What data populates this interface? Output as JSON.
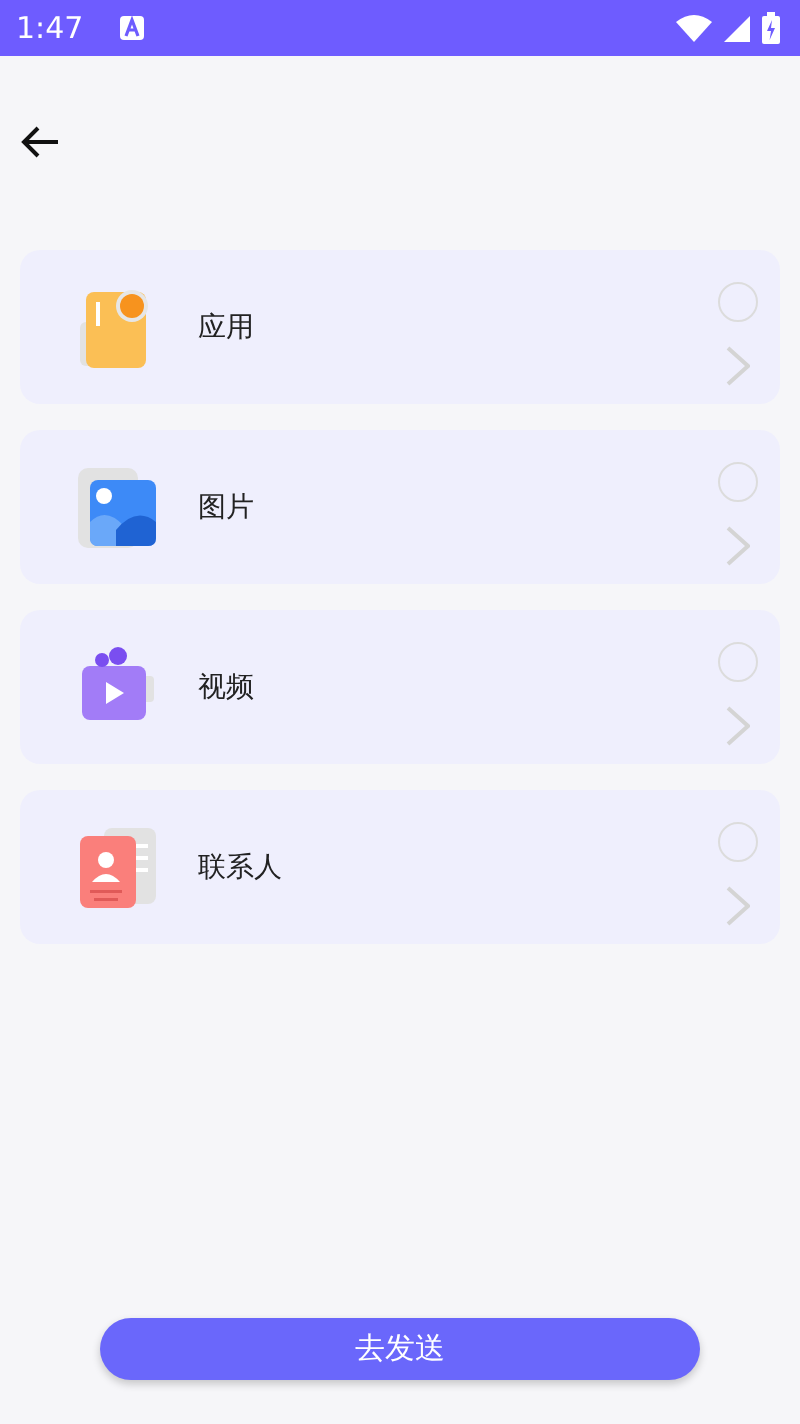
{
  "status_bar": {
    "time": "1:47"
  },
  "items": [
    {
      "kind": "app",
      "label": "应用",
      "selected": false
    },
    {
      "kind": "image",
      "label": "图片",
      "selected": false
    },
    {
      "kind": "video",
      "label": "视频",
      "selected": false
    },
    {
      "kind": "contact",
      "label": "联系人",
      "selected": false
    }
  ],
  "send_button": {
    "label": "去发送"
  }
}
